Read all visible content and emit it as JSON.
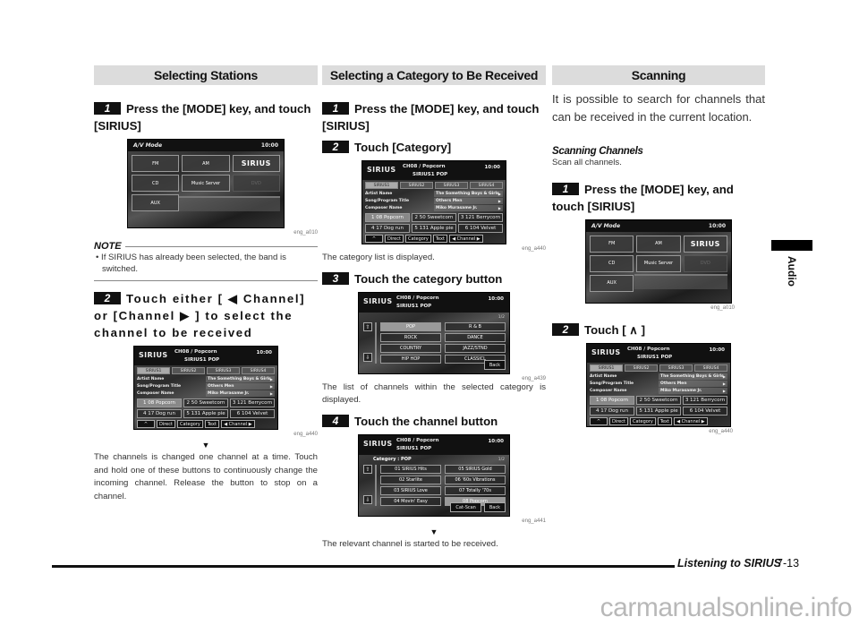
{
  "col1": {
    "title": "Selecting Stations",
    "step1": {
      "num": "1",
      "text": "Press the [MODE] key, and touch [SIRIUS]"
    },
    "screen1": {
      "header_left": "A/V Mode",
      "header_right": "10:00",
      "buttons": [
        "FM",
        "AM",
        "SIRIUS",
        "CD",
        "Music Server",
        "DVD",
        "AUX"
      ],
      "caption": "eng_a010"
    },
    "note": {
      "label": "NOTE",
      "text": "• If SIRIUS has already been selected, the band is switched."
    },
    "step2": {
      "num": "2",
      "text": "Touch either [ ◀ Channel] or [Channel ▶ ] to select the channel to be received"
    },
    "caption2": "eng_a440",
    "arrow": "▼",
    "body": "The channels is changed one channel at a time. Touch and hold one of these buttons to continuously change the incoming channel. Release the button to stop on a channel."
  },
  "tuner": {
    "logo": "SIRIUS",
    "channel": "CH08 / Popcorn",
    "band_cat": "SIRIUS1   POP",
    "time": "10:00",
    "tabs": [
      "SIRIUS1",
      "SIRIUS2",
      "SIRIUS3",
      "SIRIUS4"
    ],
    "info_labels": [
      "Artist Name",
      "Song/Program Title",
      "Composer Name"
    ],
    "info_values": [
      "The Something Boys & Girls",
      "Others Men",
      "Miko Murasame Jr."
    ],
    "presets": [
      "1  08 Popcorn",
      "2  50 Sweetcorn",
      "3  121 Berrycorn",
      "4  17 Dog run",
      "5  131 Apple pie",
      "6  104 Velvet"
    ],
    "bottom": [
      "^",
      "Direct",
      "Category",
      "Text",
      "◀ Channel ▶"
    ]
  },
  "col2": {
    "title": "Selecting a Category to Be Received",
    "step1": {
      "num": "1",
      "text": "Press the [MODE] key, and touch [SIRIUS]"
    },
    "step2": {
      "num": "2",
      "text": "Touch [Category]"
    },
    "caption_a": "eng_a440",
    "text_a": "The category list is displayed.",
    "step3": {
      "num": "3",
      "text": "Touch the category button"
    },
    "cat_screen": {
      "page": "1/2",
      "categories": [
        "POP",
        "R & B",
        "ROCK",
        "DANCE",
        "COUNTRY",
        "JAZZ/STND",
        "HIP HOP",
        "CLASSICL"
      ],
      "back": "Back"
    },
    "caption_b": "eng_a439",
    "text_b": "The list of channels within the selected category is displayed.",
    "step4": {
      "num": "4",
      "text": "Touch the channel button"
    },
    "ch_screen": {
      "category_label": "Category : POP",
      "page": "1/2",
      "channels": [
        "01 SIRIUS Hits",
        "05 SIRIUS Gold",
        "02 Starlite",
        "06 '60s Vibrations",
        "03 SIRIUS Love",
        "07 Totally '70s",
        "04 Movin' Easy",
        "08 Popcorn"
      ],
      "cat_scan": "Cat-Scan",
      "back": "Back"
    },
    "caption_c": "eng_a441",
    "arrow": "▼",
    "text_c": "The relevant channel is started to be received."
  },
  "col3": {
    "title": "Scanning",
    "intro": "It is possible to search for channels that can be received in the current location.",
    "sub_title": "Scanning Channels",
    "sub_text": "Scan all channels.",
    "step1": {
      "num": "1",
      "text": "Press the [MODE] key, and touch [SIRIUS]"
    },
    "caption1": "eng_a010",
    "step2": {
      "num": "2",
      "text": "Touch [ ∧ ]"
    },
    "caption2": "eng_a440"
  },
  "side_tab": "Audio",
  "footer": {
    "title": "Listening to SIRIUS",
    "page": "7-13"
  },
  "watermark": "carmanualsonline.info"
}
